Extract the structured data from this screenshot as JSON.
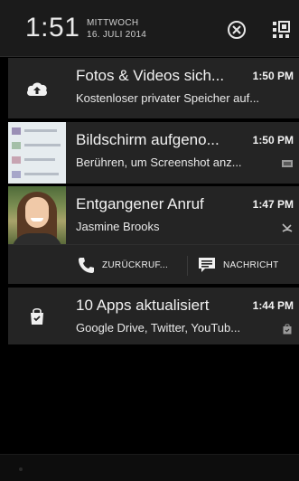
{
  "header": {
    "time": "1:51",
    "weekday": "MITTWOCH",
    "date": "16. JULI 2014"
  },
  "notifications": [
    {
      "icon": "cloud-upload-icon",
      "title": "Fotos & Videos sich...",
      "subtitle": "Kostenloser privater Speicher auf...",
      "time": "1:50 PM"
    },
    {
      "icon": "screenshot-thumbnail",
      "title": "Bildschirm aufgeno...",
      "subtitle": "Berühren, um Screenshot anz...",
      "time": "1:50 PM",
      "small_icon": "image-icon"
    },
    {
      "icon": "contact-photo",
      "title": "Entgangener Anruf",
      "subtitle": "Jasmine Brooks",
      "time": "1:47 PM",
      "small_icon": "missed-call-icon",
      "actions": [
        {
          "label": "ZURÜCKRUF...",
          "icon": "phone-icon"
        },
        {
          "label": "NACHRICHT",
          "icon": "message-icon"
        }
      ]
    },
    {
      "icon": "shopping-bag-icon",
      "title": "10 Apps aktualisiert",
      "subtitle": "Google Drive, Twitter, YouTub...",
      "time": "1:44 PM",
      "small_icon": "store-icon"
    }
  ]
}
